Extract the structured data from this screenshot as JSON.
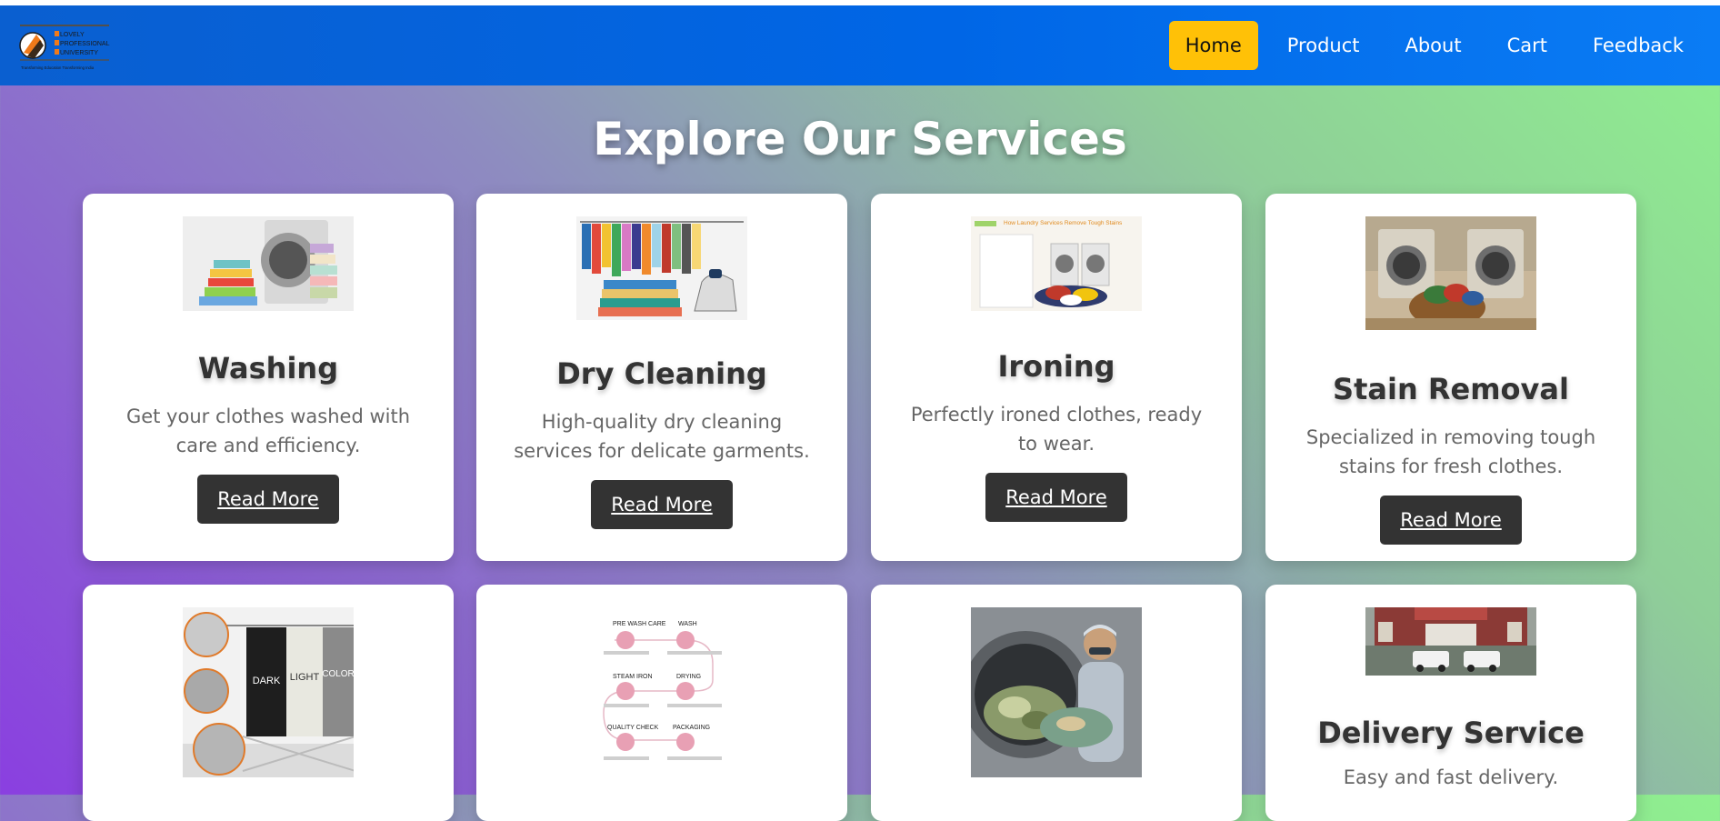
{
  "nav": {
    "logo": {
      "lines": [
        "LOVELY",
        "PROFESSIONAL",
        "UNIVERSITY"
      ],
      "tagline": "Transforming Education Transforming India"
    },
    "items": [
      {
        "label": "Home",
        "active": true
      },
      {
        "label": "Product"
      },
      {
        "label": "About"
      },
      {
        "label": "Cart"
      },
      {
        "label": "Feedback"
      }
    ]
  },
  "main": {
    "title": "Explore Our Services",
    "cards": [
      {
        "title": "Washing",
        "description": "Get your clothes washed with care and efficiency.",
        "button": "Read More",
        "image": "washing-machine-towels-photo"
      },
      {
        "title": "Dry Cleaning",
        "description": "High-quality dry cleaning services for delicate garments.",
        "button": "Read More",
        "image": "clothes-rack-iron-photo"
      },
      {
        "title": "Ironing",
        "description": "Perfectly ironed clothes, ready to wear.",
        "button": "Read More",
        "image": "laundry-room-photo",
        "image_caption": "How Laundry Services Remove Tough Stains"
      },
      {
        "title": "Stain Removal",
        "description": "Specialized in removing tough stains for fresh clothes.",
        "button": "Read More",
        "image": "washers-laundry-basket-photo"
      },
      {
        "title": "",
        "description": "",
        "button": "",
        "image": "laundry-sorter-photo",
        "image_text": [
          "DARK",
          "LIGHT",
          "COLOR"
        ]
      },
      {
        "title": "",
        "description": "",
        "button": "",
        "image": "process-steps-infographic",
        "image_text": [
          "PRE WASH CARE",
          "WASH",
          "STEAM IRON",
          "DRYING",
          "QUALITY CHECK",
          "PACKAGING"
        ]
      },
      {
        "title": "",
        "description": "",
        "button": "",
        "image": "industrial-washer-worker-photo"
      },
      {
        "title": "Delivery Service",
        "description": "Easy and fast delivery.",
        "button": "",
        "image": "hospital-building-ambulances-photo"
      }
    ]
  }
}
